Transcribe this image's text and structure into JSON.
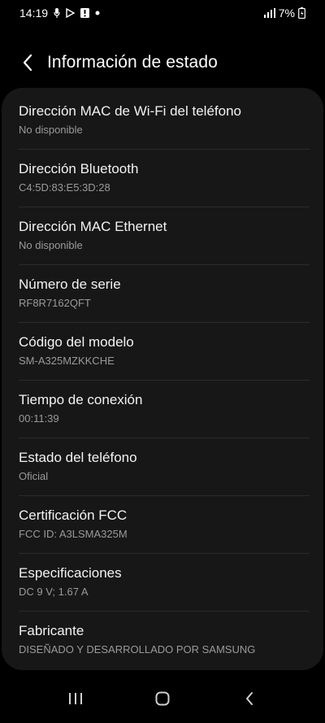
{
  "status_bar": {
    "time": "14:19",
    "battery": "7%",
    "icons_left": [
      "mic-icon",
      "play-store-icon",
      "alert-icon",
      "dot-icon"
    ],
    "icons_right": [
      "signal-icon",
      "battery-charging-icon"
    ]
  },
  "header": {
    "title": "Información de estado"
  },
  "items": [
    {
      "title": "Dirección MAC de Wi-Fi del teléfono",
      "value": "No disponible"
    },
    {
      "title": "Dirección Bluetooth",
      "value": "C4:5D:83:E5:3D:28"
    },
    {
      "title": "Dirección MAC Ethernet",
      "value": "No disponible"
    },
    {
      "title": "Número de serie",
      "value": "RF8R7162QFT"
    },
    {
      "title": "Código del modelo",
      "value": "SM-A325MZKKCHE"
    },
    {
      "title": "Tiempo de conexión",
      "value": "00:11:39"
    },
    {
      "title": "Estado del teléfono",
      "value": "Oficial"
    },
    {
      "title": "Certificación FCC",
      "value": "FCC ID: A3LSMA325M"
    },
    {
      "title": "Especificaciones",
      "value": "DC 9 V; 1.67 A"
    },
    {
      "title": "Fabricante",
      "value": "DISEÑADO Y DESARROLLADO POR SAMSUNG"
    }
  ],
  "nav_bar": {
    "buttons": [
      "recents-icon",
      "home-icon",
      "back-icon"
    ]
  },
  "colors": {
    "background": "#000000",
    "card": "#171717",
    "divider": "#2b2b2b",
    "title_text": "#f2f2f2",
    "subtitle_text": "#9a9a9a"
  }
}
